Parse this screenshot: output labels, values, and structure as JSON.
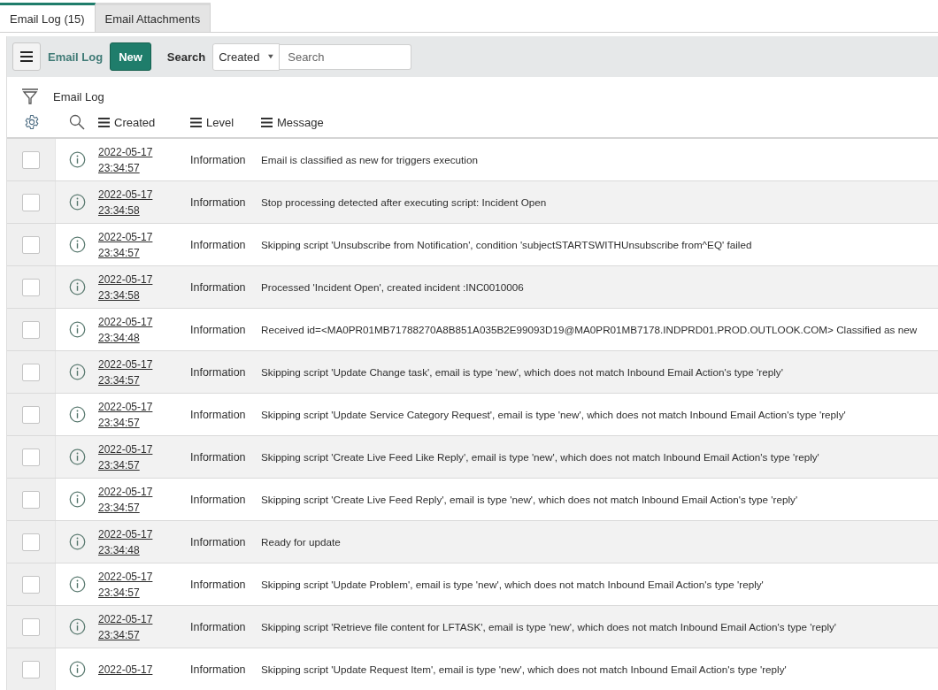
{
  "tabs": [
    {
      "label": "Email Log (15)",
      "selected": true
    },
    {
      "label": "Email Attachments",
      "selected": false
    }
  ],
  "toolbar": {
    "title": "Email Log",
    "new_button": "New",
    "search_label": "Search",
    "search_field": "Created",
    "search_placeholder": "Search"
  },
  "breadcrumb": "Email Log",
  "columns": [
    "Created",
    "Level",
    "Message"
  ],
  "rows": [
    {
      "checked": false,
      "date": "2022-05-17",
      "time": "23:34:57",
      "level": "Information",
      "message": "Email is classified as new for triggers execution"
    },
    {
      "checked": false,
      "date": "2022-05-17",
      "time": "23:34:58",
      "level": "Information",
      "message": "Stop processing detected after executing script: Incident Open"
    },
    {
      "checked": false,
      "date": "2022-05-17",
      "time": "23:34:57",
      "level": "Information",
      "message": "Skipping script 'Unsubscribe from Notification', condition 'subjectSTARTSWITHUnsubscribe from^EQ' failed"
    },
    {
      "checked": false,
      "date": "2022-05-17",
      "time": "23:34:58",
      "level": "Information",
      "message": "Processed 'Incident Open', created incident :INC0010006"
    },
    {
      "checked": false,
      "date": "2022-05-17",
      "time": "23:34:48",
      "level": "Information",
      "message": "Received id=<MA0PR01MB71788270A8B851A035B2E99093D19@MA0PR01MB7178.INDPRD01.PROD.OUTLOOK.COM> Classified as new"
    },
    {
      "checked": false,
      "date": "2022-05-17",
      "time": "23:34:57",
      "level": "Information",
      "message": "Skipping script 'Update Change task', email is type 'new', which does not match Inbound Email Action's type 'reply'"
    },
    {
      "checked": false,
      "date": "2022-05-17",
      "time": "23:34:57",
      "level": "Information",
      "message": "Skipping script 'Update Service Category Request', email is type 'new', which does not match Inbound Email Action's type 'reply'"
    },
    {
      "checked": false,
      "date": "2022-05-17",
      "time": "23:34:57",
      "level": "Information",
      "message": "Skipping script 'Create Live Feed Like Reply', email is type 'new', which does not match Inbound Email Action's type 'reply'"
    },
    {
      "checked": false,
      "date": "2022-05-17",
      "time": "23:34:57",
      "level": "Information",
      "message": "Skipping script 'Create Live Feed Reply', email is type 'new', which does not match Inbound Email Action's type 'reply'"
    },
    {
      "checked": false,
      "date": "2022-05-17",
      "time": "23:34:48",
      "level": "Information",
      "message": "Ready for update"
    },
    {
      "checked": false,
      "date": "2022-05-17",
      "time": "23:34:57",
      "level": "Information",
      "message": "Skipping script 'Update Problem', email is type 'new', which does not match Inbound Email Action's type 'reply'"
    },
    {
      "checked": false,
      "date": "2022-05-17",
      "time": "23:34:57",
      "level": "Information",
      "message": "Skipping script 'Retrieve file content for LFTASK', email is type 'new', which does not match Inbound Email Action's type 'reply'"
    },
    {
      "checked": false,
      "date": "2022-05-17",
      "level": "Information",
      "message": "Skipping script 'Update Request Item', email is type 'new', which does not match Inbound Email Action's type 'reply'"
    }
  ]
}
